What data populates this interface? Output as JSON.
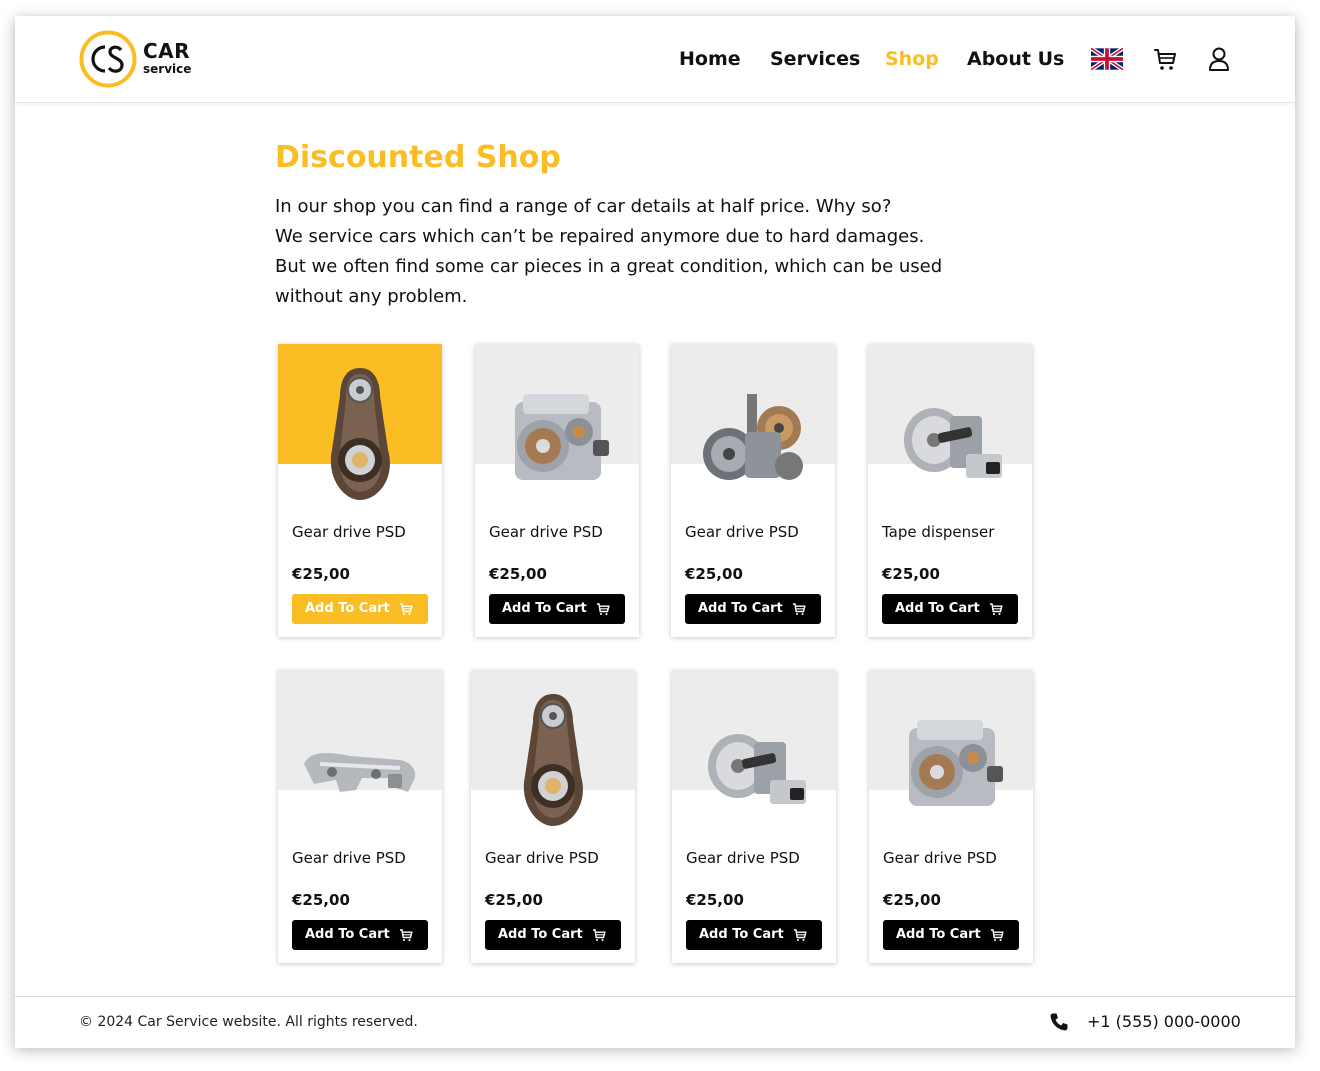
{
  "brand": {
    "logo_letters": "CS",
    "name": "CAR",
    "tagline": "service",
    "accent_color": "#fbbd24"
  },
  "nav": {
    "items": [
      {
        "label": "Home",
        "active": false
      },
      {
        "label": "Services",
        "active": false
      },
      {
        "label": "Shop",
        "active": true
      },
      {
        "label": "About Us",
        "active": false
      }
    ],
    "language_icon": "uk-flag-icon",
    "cart_icon": "cart-icon",
    "account_icon": "user-icon"
  },
  "main": {
    "title": "Discounted Shop",
    "intro": [
      "In our shop you can find a range of car details at half price. Why so?",
      "We service cars which can’t be repaired anymore due to hard damages.",
      "But we often find some car pieces in a great condition, which can be used",
      "without any problem."
    ]
  },
  "products": [
    {
      "name": "Gear drive PSD",
      "price": "€25,00",
      "button": "Add To Cart",
      "image": "tensioner-pulley",
      "highlighted": true
    },
    {
      "name": "Gear drive PSD",
      "price": "€25,00",
      "button": "Add To Cart",
      "image": "gear-drive",
      "highlighted": false
    },
    {
      "name": "Gear drive PSD",
      "price": "€25,00",
      "button": "Add To Cart",
      "image": "gear-mechanism",
      "highlighted": false
    },
    {
      "name": "Tape dispenser",
      "price": "€25,00",
      "button": "Add To Cart",
      "image": "winch",
      "highlighted": false
    },
    {
      "name": "Gear drive PSD",
      "price": "€25,00",
      "button": "Add To Cart",
      "image": "bracket",
      "highlighted": false
    },
    {
      "name": "Gear drive PSD",
      "price": "€25,00",
      "button": "Add To Cart",
      "image": "tensioner-pulley",
      "highlighted": false
    },
    {
      "name": "Gear drive PSD",
      "price": "€25,00",
      "button": "Add To Cart",
      "image": "winch",
      "highlighted": false
    },
    {
      "name": "Gear drive PSD",
      "price": "€25,00",
      "button": "Add To Cart",
      "image": "gear-drive",
      "highlighted": false
    }
  ],
  "footer": {
    "copyright": "© 2024 Car Service website. All rights reserved.",
    "phone_icon": "phone-icon",
    "phone": "+1 (555) 000-0000"
  }
}
